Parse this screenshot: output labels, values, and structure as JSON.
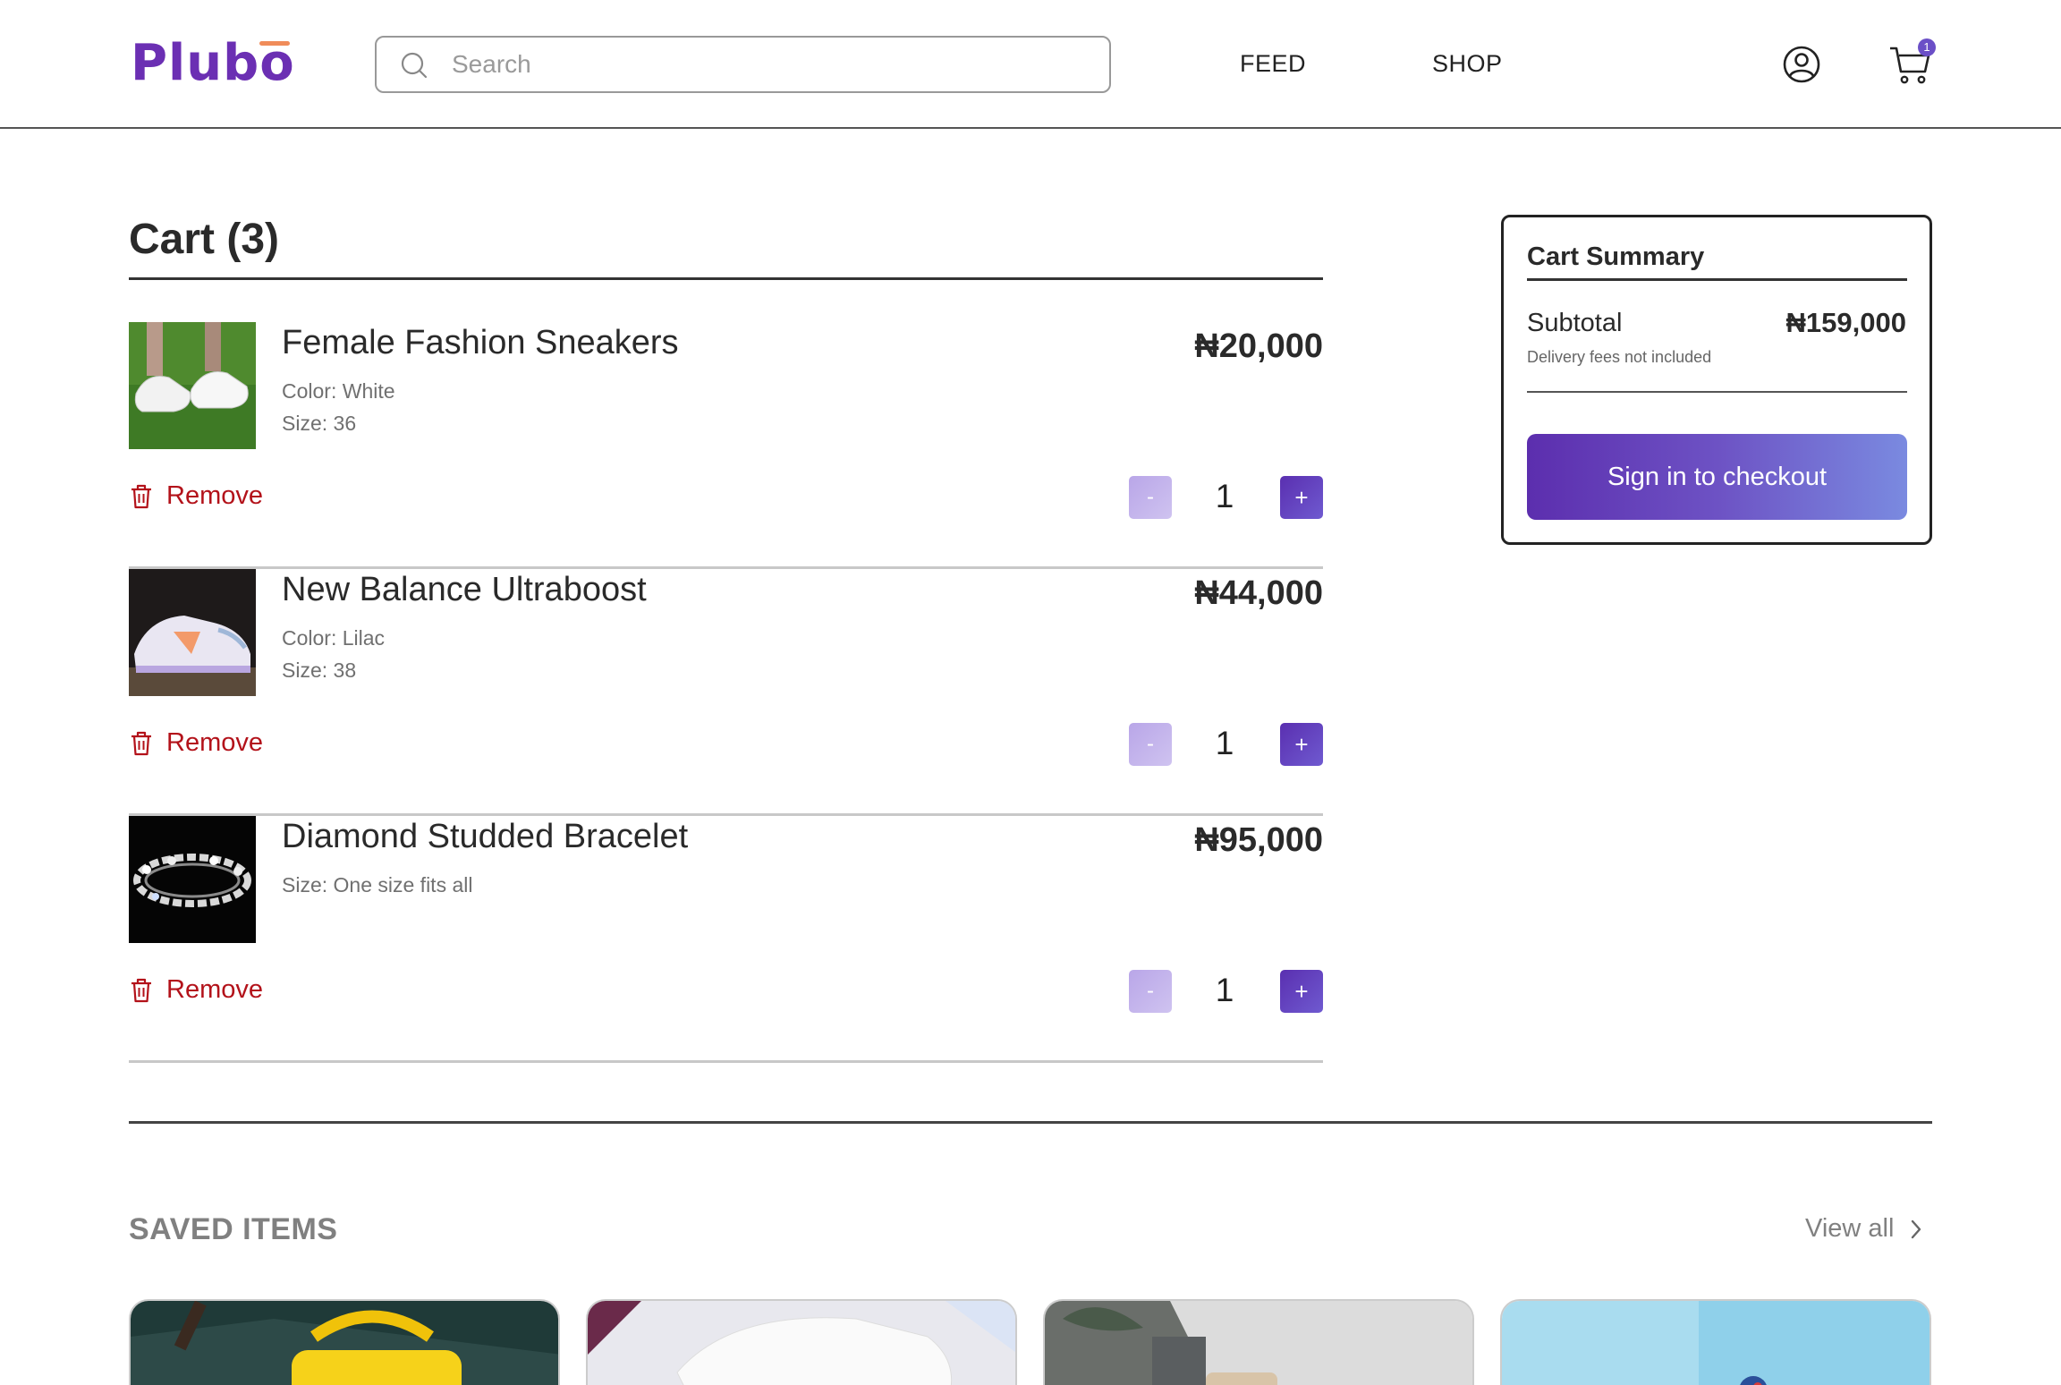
{
  "header": {
    "logo": "Plubo",
    "search_placeholder": "Search",
    "nav": {
      "feed": "FEED",
      "shop": "SHOP"
    },
    "cart_badge": "1",
    "icons": [
      "search-icon",
      "account-icon",
      "cart-icon"
    ]
  },
  "cart": {
    "title": "Cart (3)",
    "remove_label": "Remove",
    "items": [
      {
        "name": "Female Fashion Sneakers",
        "attr1": "Color: White",
        "attr2": "Size: 36",
        "price": "₦20,000",
        "qty": "1"
      },
      {
        "name": "New Balance Ultraboost",
        "attr1": "Color: Lilac",
        "attr2": "Size: 38",
        "price": "₦44,000",
        "qty": "1"
      },
      {
        "name": "Diamond Studded Bracelet",
        "attr1": "Size: One size fits all",
        "attr2": "",
        "price": "₦95,000",
        "qty": "1"
      }
    ],
    "minus_label": "-",
    "plus_label": "+"
  },
  "summary": {
    "title": "Cart Summary",
    "subtotal_label": "Subtotal",
    "subtotal_value": "₦159,000",
    "note": "Delivery fees not included",
    "checkout_label": "Sign in to checkout"
  },
  "saved": {
    "title": "SAVED ITEMS",
    "view_all": "View all"
  },
  "colors": {
    "brand": "#6b2fb3",
    "accent": "#f08c5a",
    "remove": "#b3121a",
    "checkout_start": "#5c2eae",
    "checkout_end": "#7a8ae0"
  }
}
